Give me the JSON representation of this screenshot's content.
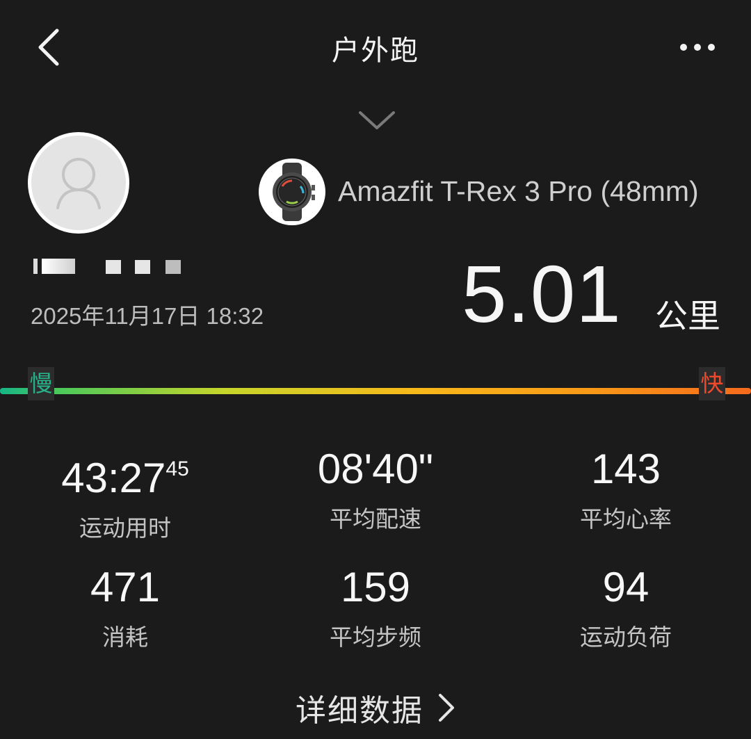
{
  "header": {
    "title": "户外跑"
  },
  "device": {
    "name": "Amazfit T-Rex 3 Pro (48mm)"
  },
  "workout": {
    "date": "2025年11月17日 18:32",
    "distance": "5.01",
    "distance_unit": "公里"
  },
  "pace_bar": {
    "slow_label": "慢",
    "fast_label": "快"
  },
  "stats": {
    "duration_main": "43:27",
    "duration_fraction": "45",
    "duration_label": "运动用时",
    "pace_value": "08'40\"",
    "pace_label": "平均配速",
    "heart_rate_value": "143",
    "heart_rate_label": "平均心率",
    "calories_value": "471",
    "calories_label": "消耗",
    "cadence_value": "159",
    "cadence_label": "平均步频",
    "load_value": "94",
    "load_label": "运动负荷"
  },
  "footer": {
    "details_label": "详细数据"
  },
  "colors": {
    "background": "#1b1b1b",
    "slow": "#28b28a",
    "fast": "#f04a2c"
  },
  "icons": [
    "back-arrow-icon",
    "more-dots-icon",
    "chevron-down-icon",
    "user-silhouette-icon",
    "watch-icon",
    "chevron-right-icon"
  ]
}
